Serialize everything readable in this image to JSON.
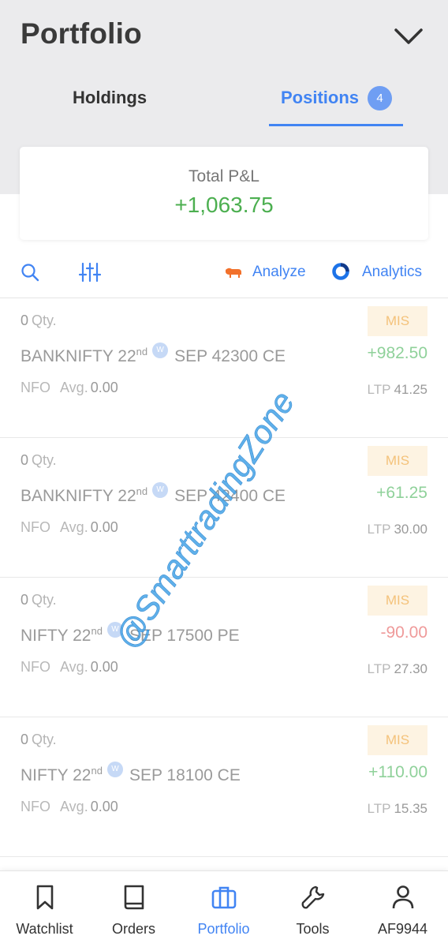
{
  "header": {
    "title": "Portfolio"
  },
  "tabs": [
    {
      "label": "Holdings",
      "active": false
    },
    {
      "label": "Positions",
      "badge": "4",
      "active": true
    }
  ],
  "summary": {
    "label": "Total P&L",
    "value": "+1,063.75"
  },
  "toolbar": {
    "analyze_label": "Analyze",
    "analytics_label": "Analytics"
  },
  "watermark": "@SmarttradingZone",
  "positions": [
    {
      "qty": "0",
      "qty_unit": "Qty.",
      "symbol": "BANKNIFTY 22",
      "day_suffix": "nd",
      "weekly": "W",
      "contract": "SEP 42300 CE",
      "exchange": "NFO",
      "avg_label": "Avg.",
      "avg": "0.00",
      "product": "MIS",
      "pnl": "+982.50",
      "ltp_label": "LTP",
      "ltp": "41.25"
    },
    {
      "qty": "0",
      "qty_unit": "Qty.",
      "symbol": "BANKNIFTY 22",
      "day_suffix": "nd",
      "weekly": "W",
      "contract": "SEP 42400 CE",
      "exchange": "NFO",
      "avg_label": "Avg.",
      "avg": "0.00",
      "product": "MIS",
      "pnl": "+61.25",
      "ltp_label": "LTP",
      "ltp": "30.00"
    },
    {
      "qty": "0",
      "qty_unit": "Qty.",
      "symbol": "NIFTY 22",
      "day_suffix": "nd",
      "weekly": "W",
      "contract": "SEP 17500 PE",
      "exchange": "NFO",
      "avg_label": "Avg.",
      "avg": "0.00",
      "product": "MIS",
      "pnl": "-90.00",
      "ltp_label": "LTP",
      "ltp": "27.30"
    },
    {
      "qty": "0",
      "qty_unit": "Qty.",
      "symbol": "NIFTY 22",
      "day_suffix": "nd",
      "weekly": "W",
      "contract": "SEP 18100 CE",
      "exchange": "NFO",
      "avg_label": "Avg.",
      "avg": "0.00",
      "product": "MIS",
      "pnl": "+110.00",
      "ltp_label": "LTP",
      "ltp": "15.35"
    }
  ],
  "bottom_nav": [
    {
      "label": "Watchlist",
      "icon": "bookmark-icon"
    },
    {
      "label": "Orders",
      "icon": "book-icon"
    },
    {
      "label": "Portfolio",
      "icon": "briefcase-icon",
      "active": true
    },
    {
      "label": "Tools",
      "icon": "wrench-icon"
    },
    {
      "label": "AF9944",
      "icon": "user-icon"
    }
  ],
  "colors": {
    "accent": "#4184f3",
    "profit": "#4caf50",
    "loss": "#ef9a9a",
    "mis_bg": "#fdf3e2",
    "mis_text": "#f4c27a"
  }
}
